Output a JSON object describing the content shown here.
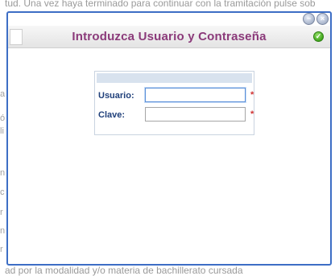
{
  "background": {
    "top_text": "tud. Una vez haya terminado para continuar con la tramitación pulse sob",
    "bottom_text": "ad por la modalidad y/o materia de bachillerato cursada",
    "left_letters": [
      "a",
      "ó",
      "li",
      "n",
      "c",
      "r",
      "n",
      "r",
      "n"
    ]
  },
  "window": {
    "title": "Introduzca Usuario y Contraseña",
    "minimize_glyph": "−",
    "close_glyph": "×",
    "ok_glyph": "✓"
  },
  "login": {
    "user_label": "Usuario:",
    "user_value": "",
    "password_label": "Clave:",
    "password_value": "",
    "required_mark": "*"
  }
}
